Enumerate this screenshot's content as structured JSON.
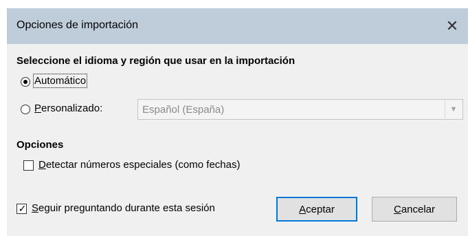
{
  "dialog": {
    "title": "Opciones de importación",
    "close_icon": "close-icon"
  },
  "language_section": {
    "heading": "Seleccione el idioma y región que usar en la importación",
    "auto_radio": {
      "label": "Automático",
      "selected": true
    },
    "custom_radio": {
      "label_accel": "P",
      "label_rest": "ersonalizado:",
      "selected": false
    },
    "language_select": {
      "value": "Español (España)",
      "enabled": false
    }
  },
  "options_section": {
    "heading": "Opciones",
    "detect_numbers": {
      "label_accel": "D",
      "label_rest": "etectar números especiales (como fechas)",
      "checked": false
    }
  },
  "footer": {
    "keep_asking": {
      "label_accel": "S",
      "label_rest": "eguir preguntando durante esta sesión",
      "checked": true
    },
    "accept_button": {
      "label_accel": "A",
      "label_rest": "ceptar"
    },
    "cancel_button": {
      "label_accel": "C",
      "label_rest": "ancelar"
    }
  },
  "colors": {
    "titlebar": "#bfcddb",
    "dialog_bg": "#f0f0f0",
    "default_button_border": "#0078d7"
  }
}
